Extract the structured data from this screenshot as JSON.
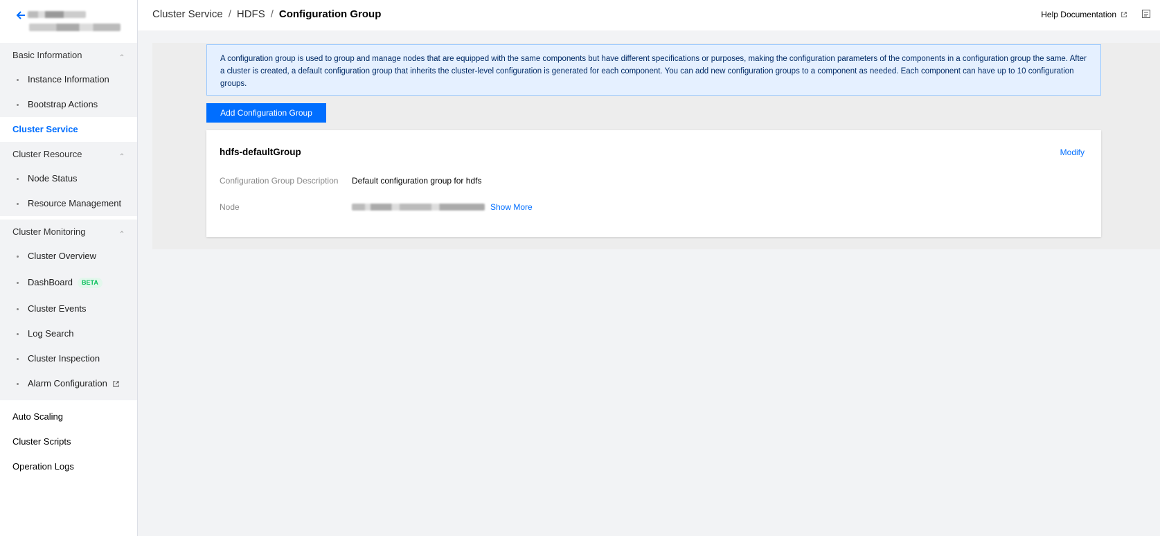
{
  "sidebar": {
    "groups": [
      {
        "title": "Basic Information",
        "items": [
          "Instance Information",
          "Bootstrap Actions"
        ]
      },
      {
        "title": "Cluster Resource",
        "items": [
          "Node Status",
          "Resource Management"
        ]
      },
      {
        "title": "Cluster Monitoring",
        "items": [
          "Cluster Overview",
          "DashBoard",
          "Cluster Events",
          "Log Search",
          "Cluster Inspection",
          "Alarm Configuration"
        ]
      }
    ],
    "cluster_service": "Cluster Service",
    "dashboard_badge": "BETA",
    "bottom_items": [
      "Auto Scaling",
      "Cluster Scripts",
      "Operation Logs"
    ]
  },
  "header": {
    "breadcrumb": [
      "Cluster Service",
      "HDFS",
      "Configuration Group"
    ],
    "help": "Help Documentation"
  },
  "main": {
    "info_text": "A configuration group is used to group and manage nodes that are equipped with the same components but have different specifications or purposes, making the configuration parameters of the components in a configuration group the same. After a cluster is created, a default configuration group that inherits the cluster-level configuration is generated for each component. You can add new configuration groups to a component as needed. Each component can have up to 10 configuration groups.",
    "add_button": "Add Configuration Group",
    "card": {
      "title": "hdfs-defaultGroup",
      "modify": "Modify",
      "desc_label": "Configuration Group Description",
      "desc_value": "Default configuration group for hdfs",
      "node_label": "Node",
      "show_more": "Show More"
    }
  },
  "colors": {
    "accent": "#006eff",
    "badge": "#0abf5b"
  }
}
